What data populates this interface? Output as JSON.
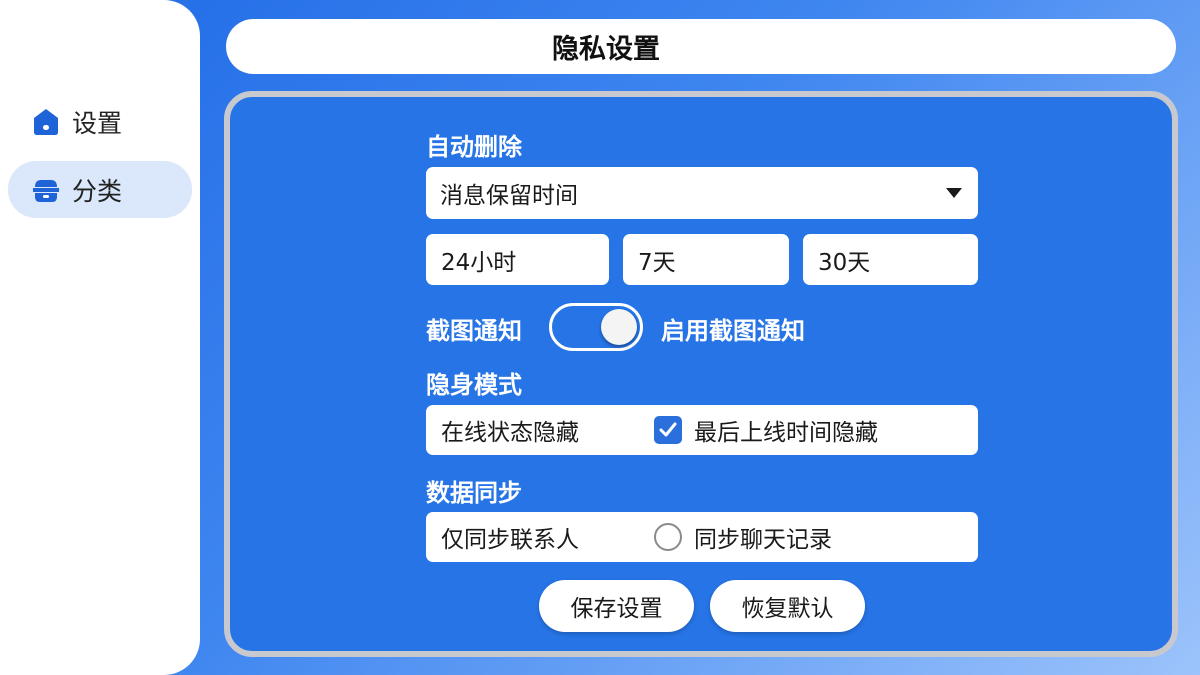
{
  "header": {
    "title": "隐私设置"
  },
  "sidebar": {
    "items": [
      {
        "label": "设置",
        "icon": "home-icon"
      },
      {
        "label": "分类",
        "icon": "category-icon"
      }
    ]
  },
  "auto_delete": {
    "title": "自动删除",
    "select_value": "消息保留时间",
    "options": [
      "24小时",
      "7天",
      "30天"
    ]
  },
  "screenshot": {
    "label": "截图通知",
    "toggle_on": true,
    "desc": "启用截图通知"
  },
  "stealth": {
    "title": "隐身模式",
    "option1": "在线状态隐藏",
    "option2": "最后上线时间隐藏",
    "option2_checked": true
  },
  "sync": {
    "title": "数据同步",
    "option1": "仅同步联系人",
    "option2": "同步聊天记录",
    "option2_selected": false
  },
  "buttons": {
    "save": "保存设置",
    "reset": "恢复默认"
  },
  "colors": {
    "accent": "#2674e6",
    "panel_border": "#c7c9cf",
    "sidebar_active": "#dbe7fa",
    "icon": "#1f63d8"
  }
}
